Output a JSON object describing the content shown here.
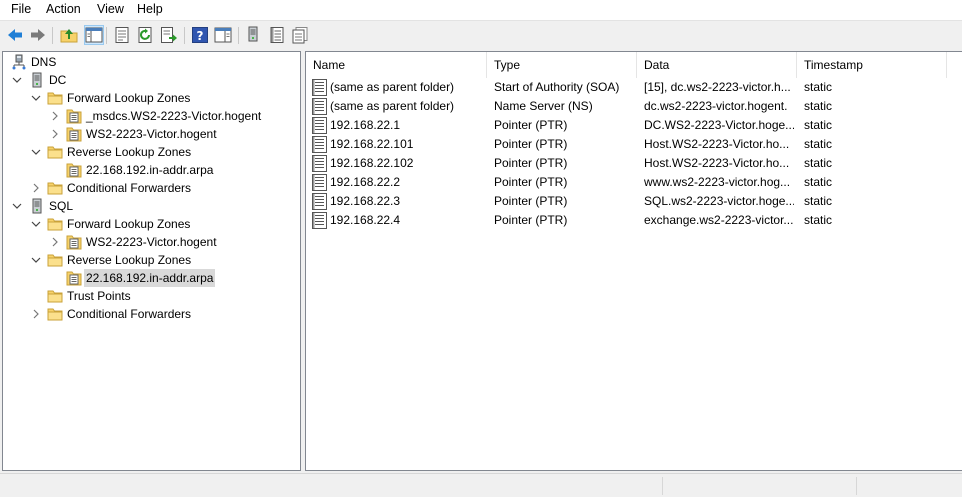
{
  "menu": [
    {
      "id": "file",
      "label": "File"
    },
    {
      "id": "action",
      "label": "Action"
    },
    {
      "id": "view",
      "label": "View"
    },
    {
      "id": "help",
      "label": "Help"
    }
  ],
  "tree": [
    {
      "label": "DNS",
      "level": 0,
      "icon": "dns-root-icon",
      "expander": "none"
    },
    {
      "label": "DC",
      "level": 1,
      "icon": "server-icon",
      "expander": "expanded"
    },
    {
      "label": "Forward Lookup Zones",
      "level": 2,
      "icon": "folder-icon",
      "expander": "expanded"
    },
    {
      "label": "_msdcs.WS2-2223-Victor.hogent",
      "level": 3,
      "icon": "zone-icon",
      "expander": "collapsed"
    },
    {
      "label": "WS2-2223-Victor.hogent",
      "level": 3,
      "icon": "zone-icon",
      "expander": "collapsed"
    },
    {
      "label": "Reverse Lookup Zones",
      "level": 2,
      "icon": "folder-icon",
      "expander": "expanded"
    },
    {
      "label": "22.168.192.in-addr.arpa",
      "level": 3,
      "icon": "zone-icon",
      "expander": "none"
    },
    {
      "label": "Conditional Forwarders",
      "level": 2,
      "icon": "folder-icon",
      "expander": "collapsed"
    },
    {
      "label": "SQL",
      "level": 1,
      "icon": "server-icon",
      "expander": "expanded"
    },
    {
      "label": "Forward Lookup Zones",
      "level": 2,
      "icon": "folder-icon",
      "expander": "expanded"
    },
    {
      "label": "WS2-2223-Victor.hogent",
      "level": 3,
      "icon": "zone-icon",
      "expander": "collapsed"
    },
    {
      "label": "Reverse Lookup Zones",
      "level": 2,
      "icon": "folder-icon",
      "expander": "expanded"
    },
    {
      "label": "22.168.192.in-addr.arpa",
      "level": 3,
      "icon": "zone-icon",
      "expander": "none",
      "selected": true
    },
    {
      "label": "Trust Points",
      "level": 2,
      "icon": "folder-icon",
      "expander": "none"
    },
    {
      "label": "Conditional Forwarders",
      "level": 2,
      "icon": "folder-icon",
      "expander": "collapsed"
    }
  ],
  "list": {
    "columns": [
      "Name",
      "Type",
      "Data",
      "Timestamp"
    ],
    "rows": [
      {
        "name": "(same as parent folder)",
        "type": "Start of Authority (SOA)",
        "data": "[15], dc.ws2-2223-victor.h...",
        "timestamp": "static"
      },
      {
        "name": "(same as parent folder)",
        "type": "Name Server (NS)",
        "data": "dc.ws2-2223-victor.hogent.",
        "timestamp": "static"
      },
      {
        "name": "192.168.22.1",
        "type": "Pointer (PTR)",
        "data": "DC.WS2-2223-Victor.hoge...",
        "timestamp": "static"
      },
      {
        "name": "192.168.22.101",
        "type": "Pointer (PTR)",
        "data": "Host.WS2-2223-Victor.ho...",
        "timestamp": "static"
      },
      {
        "name": "192.168.22.102",
        "type": "Pointer (PTR)",
        "data": "Host.WS2-2223-Victor.ho...",
        "timestamp": "static"
      },
      {
        "name": "192.168.22.2",
        "type": "Pointer (PTR)",
        "data": "www.ws2-2223-victor.hog...",
        "timestamp": "static"
      },
      {
        "name": "192.168.22.3",
        "type": "Pointer (PTR)",
        "data": "SQL.ws2-2223-victor.hoge...",
        "timestamp": "static"
      },
      {
        "name": "192.168.22.4",
        "type": "Pointer (PTR)",
        "data": "exchange.ws2-2223-victor...",
        "timestamp": "static"
      }
    ]
  },
  "toolbar": [
    "back-arrow-icon",
    "forward-arrow-icon",
    "up-folder-icon",
    "show-hide-console-tree-icon",
    "properties-icon",
    "refresh-icon",
    "export-list-icon",
    "help-icon",
    "action-pane-icon",
    "server-icon",
    "record-list-icon",
    "record-copy-icon"
  ],
  "colors": {
    "selection": "#d9d9d9",
    "folder": "#f7d26a",
    "arrow_blue": "#1f7fd6",
    "arrow_gray": "#7a7a7a"
  }
}
